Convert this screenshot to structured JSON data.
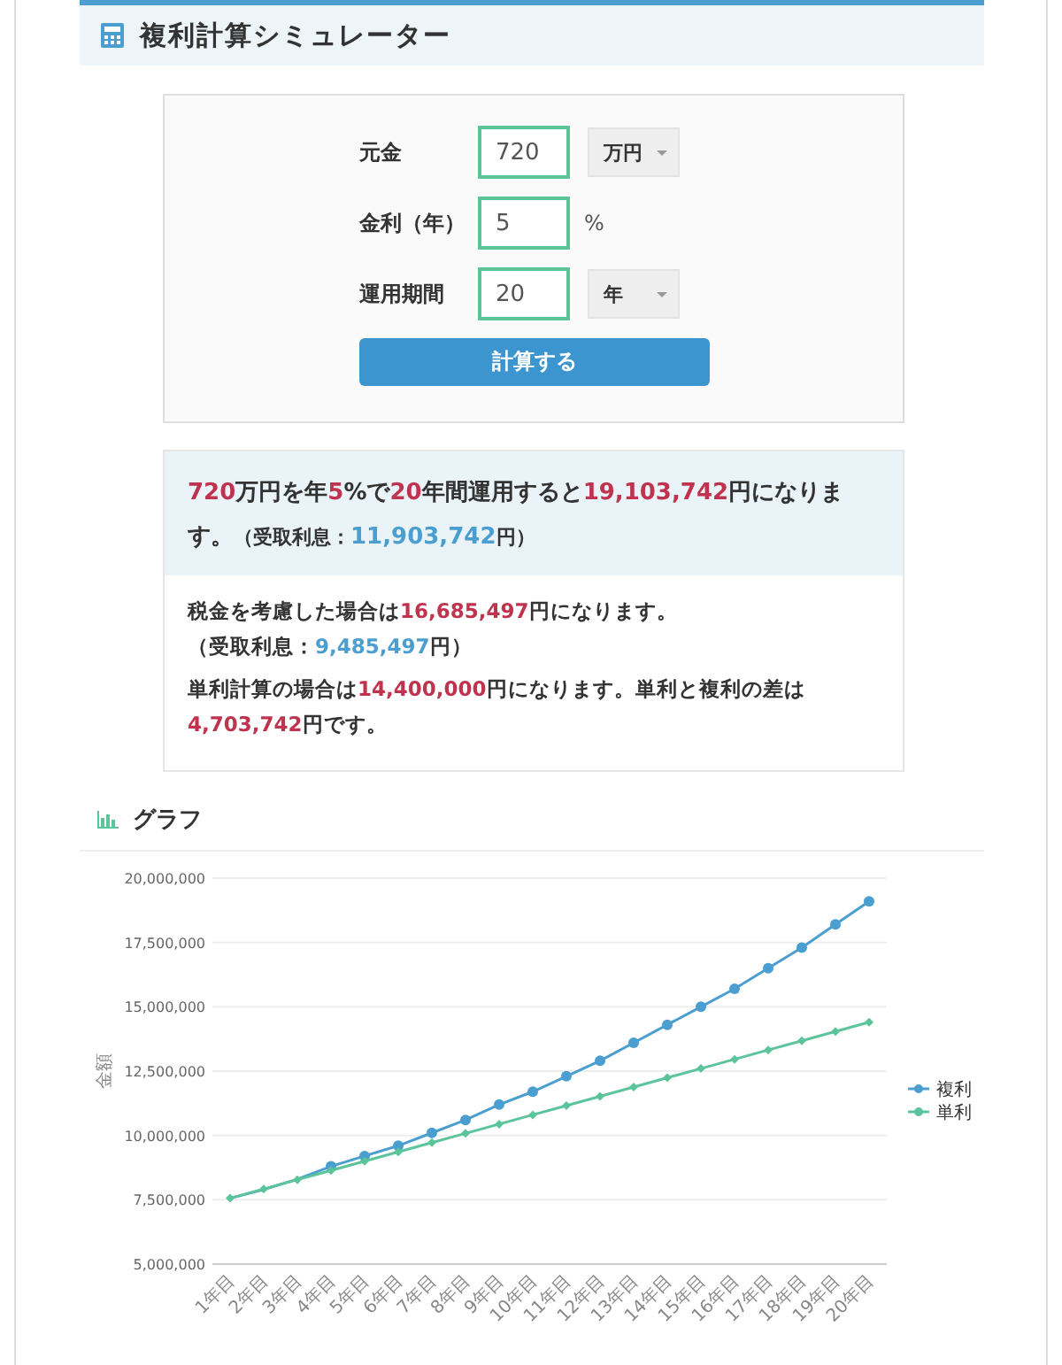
{
  "header": {
    "title": "複利計算シミュレーター"
  },
  "form": {
    "fields": [
      {
        "label": "元金",
        "value": "720",
        "kind": "select",
        "unit": "万円"
      },
      {
        "label": "金利（年）",
        "value": "5",
        "kind": "text",
        "unit": "%"
      },
      {
        "label": "運用期間",
        "value": "20",
        "kind": "select",
        "unit": "年"
      }
    ],
    "button": "計算する"
  },
  "result": {
    "headline": [
      {
        "text": "720",
        "kind": "red"
      },
      {
        "text": "万円を年",
        "kind": "plain"
      },
      {
        "text": "5",
        "kind": "red"
      },
      {
        "text": "%で",
        "kind": "plain"
      },
      {
        "text": "20",
        "kind": "red"
      },
      {
        "text": "年間運用すると",
        "kind": "plain"
      },
      {
        "text": "19,103,742",
        "kind": "red"
      },
      {
        "text": "円になります。",
        "kind": "plain"
      },
      {
        "text": "（受取利息：",
        "kind": "small"
      },
      {
        "text": "11,903,742",
        "kind": "blue"
      },
      {
        "text": "円）",
        "kind": "small"
      }
    ],
    "paragraphs": [
      [
        {
          "text": "税金を考慮した場合は",
          "kind": "plain"
        },
        {
          "text": "16,685,497",
          "kind": "red"
        },
        {
          "text": "円になります。",
          "kind": "plain"
        },
        {
          "text": "（受取利息：",
          "kind": "break"
        },
        {
          "text": "9,485,497",
          "kind": "blue"
        },
        {
          "text": "円）",
          "kind": "plain"
        }
      ],
      [
        {
          "text": "単利計算の場合は",
          "kind": "plain"
        },
        {
          "text": "14,400,000",
          "kind": "red"
        },
        {
          "text": "円になります。単利と複利の差は",
          "kind": "plain"
        },
        {
          "text": "4,703,742",
          "kind": "red"
        },
        {
          "text": "円です。",
          "kind": "plain"
        }
      ]
    ]
  },
  "graph": {
    "title": "グラフ",
    "chart_data": {
      "type": "line",
      "ylabel": "金額",
      "categories": [
        "1年目",
        "2年目",
        "3年目",
        "4年目",
        "5年目",
        "6年目",
        "7年目",
        "8年目",
        "9年目",
        "10年目",
        "11年目",
        "12年目",
        "13年目",
        "14年目",
        "15年目",
        "16年目",
        "17年目",
        "18年目",
        "19年目",
        "20年目"
      ],
      "series": [
        {
          "name": "複利",
          "color": "#4a9fd0",
          "marker": "circle",
          "values": [
            7560000,
            7900000,
            8300000,
            8800000,
            9200000,
            9600000,
            10100000,
            10600000,
            11200000,
            11700000,
            12300000,
            12900000,
            13600000,
            14300000,
            15000000,
            15700000,
            16500000,
            17300000,
            18200000,
            19100000
          ]
        },
        {
          "name": "単利",
          "color": "#5cc49a",
          "marker": "diamond",
          "values": [
            7560000,
            7920000,
            8280000,
            8640000,
            9000000,
            9360000,
            9720000,
            10080000,
            10440000,
            10800000,
            11160000,
            11520000,
            11880000,
            12240000,
            12600000,
            12960000,
            13320000,
            13680000,
            14040000,
            14400000
          ]
        }
      ],
      "ylim": [
        5000000,
        20000000
      ],
      "grid": true,
      "legend": true,
      "yticks": [
        {
          "value": 5000000,
          "label": "5,000,000"
        },
        {
          "value": 7500000,
          "label": "7,500,000"
        },
        {
          "value": 10000000,
          "label": "10,000,000"
        },
        {
          "value": 12500000,
          "label": "12,500,000"
        },
        {
          "value": 15000000,
          "label": "15,000,000"
        },
        {
          "value": 17500000,
          "label": "17,500,000"
        },
        {
          "value": 20000000,
          "label": "20,000,000"
        }
      ]
    }
  }
}
